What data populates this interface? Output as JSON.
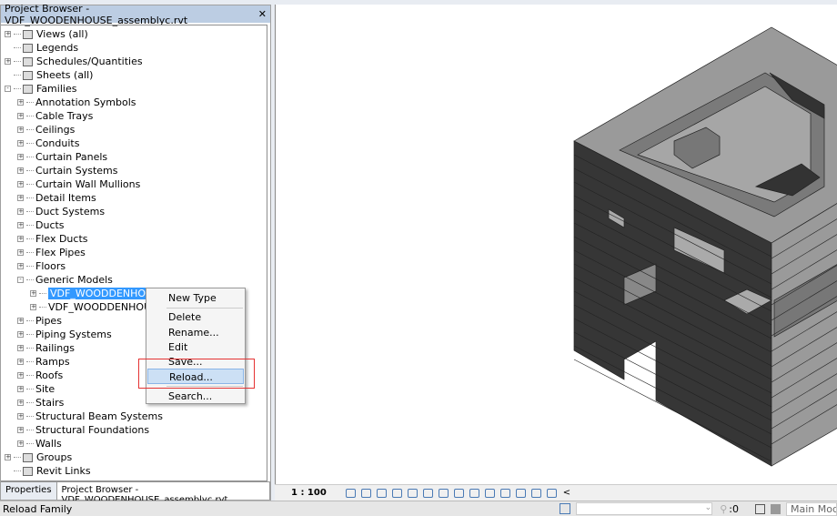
{
  "project_browser": {
    "title": "Project Browser - VDF_WOODENHOUSE_assemblyc.rvt",
    "close": "✕",
    "items": [
      {
        "label": "Views (all)",
        "level": 0,
        "exp": "+",
        "icon": "views-icon"
      },
      {
        "label": "Legends",
        "level": 0,
        "exp": "",
        "icon": "legend-icon"
      },
      {
        "label": "Schedules/Quantities",
        "level": 0,
        "exp": "+",
        "icon": "schedule-icon"
      },
      {
        "label": "Sheets (all)",
        "level": 0,
        "exp": "",
        "icon": "sheet-icon"
      },
      {
        "label": "Families",
        "level": 0,
        "exp": "-",
        "icon": "families-icon"
      },
      {
        "label": "Annotation Symbols",
        "level": 1,
        "exp": "+"
      },
      {
        "label": "Cable Trays",
        "level": 1,
        "exp": "+"
      },
      {
        "label": "Ceilings",
        "level": 1,
        "exp": "+"
      },
      {
        "label": "Conduits",
        "level": 1,
        "exp": "+"
      },
      {
        "label": "Curtain Panels",
        "level": 1,
        "exp": "+"
      },
      {
        "label": "Curtain Systems",
        "level": 1,
        "exp": "+"
      },
      {
        "label": "Curtain Wall Mullions",
        "level": 1,
        "exp": "+"
      },
      {
        "label": "Detail Items",
        "level": 1,
        "exp": "+"
      },
      {
        "label": "Duct Systems",
        "level": 1,
        "exp": "+"
      },
      {
        "label": "Ducts",
        "level": 1,
        "exp": "+"
      },
      {
        "label": "Flex Ducts",
        "level": 1,
        "exp": "+"
      },
      {
        "label": "Flex Pipes",
        "level": 1,
        "exp": "+"
      },
      {
        "label": "Floors",
        "level": 1,
        "exp": "+"
      },
      {
        "label": "Generic Models",
        "level": 1,
        "exp": "-"
      },
      {
        "label": "VDF_WOODDENHOUSE_",
        "level": 2,
        "exp": "+",
        "selected": true
      },
      {
        "label": "VDF_WOODDENHOUSE_",
        "level": 2,
        "exp": "+"
      },
      {
        "label": "Pipes",
        "level": 1,
        "exp": "+"
      },
      {
        "label": "Piping Systems",
        "level": 1,
        "exp": "+"
      },
      {
        "label": "Railings",
        "level": 1,
        "exp": "+"
      },
      {
        "label": "Ramps",
        "level": 1,
        "exp": "+"
      },
      {
        "label": "Roofs",
        "level": 1,
        "exp": "+"
      },
      {
        "label": "Site",
        "level": 1,
        "exp": "+"
      },
      {
        "label": "Stairs",
        "level": 1,
        "exp": "+"
      },
      {
        "label": "Structural Beam Systems",
        "level": 1,
        "exp": "+"
      },
      {
        "label": "Structural Foundations",
        "level": 1,
        "exp": "+"
      },
      {
        "label": "Walls",
        "level": 1,
        "exp": "+"
      },
      {
        "label": "Groups",
        "level": 0,
        "exp": "+",
        "icon": "groups-icon"
      },
      {
        "label": "Revit Links",
        "level": 0,
        "exp": "",
        "icon": "link-icon"
      }
    ],
    "tabs": [
      {
        "label": "Properties"
      },
      {
        "label": "Project Browser - VDF_WOODENHOUSE_assemblyc.rvt",
        "active": true
      }
    ]
  },
  "context_menu": {
    "items": [
      "New Type",
      "Delete",
      "Rename...",
      "Edit",
      "Save...",
      "Reload...",
      "Search..."
    ],
    "highlighted": "Reload..."
  },
  "view_bar": {
    "scale": "1 : 100",
    "collapse": "<"
  },
  "status_bar": {
    "message": "Reload Family",
    "selection_count": ":0",
    "model": "Main Mode"
  }
}
